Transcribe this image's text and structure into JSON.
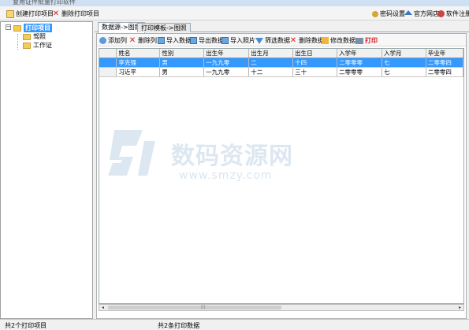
{
  "window": {
    "title": "复用证件批量打印软件"
  },
  "toolbar": {
    "create_label": "创建打印项目",
    "delete_label": "删除打印项目",
    "password_label": "密码设置",
    "shop_label": "官方网店",
    "register_label": "软件注册"
  },
  "sidebar": {
    "root": {
      "toggle": "−",
      "label": "打印项目"
    },
    "items": [
      {
        "label": "驾照"
      },
      {
        "label": "工作证"
      }
    ]
  },
  "tabs": [
    {
      "label": "数据源->图照",
      "active": true
    },
    {
      "label": "打印模板->图照",
      "active": false
    }
  ],
  "panel_toolbar": {
    "add_column": "添加列",
    "delete_column": "删除列",
    "import_data": "导入数据",
    "export_data": "导出数据",
    "import_photo": "导入照片",
    "filter_data": "筛选数据",
    "delete_data": "删除数据",
    "edit_data": "修改数据",
    "print": "打印"
  },
  "table": {
    "columns": [
      "姓名",
      "性别",
      "出生年",
      "出生月",
      "出生日",
      "入学年",
      "入学月",
      "毕业年"
    ],
    "rows": [
      [
        "李克强",
        "男",
        "一九九零",
        "二",
        "十四",
        "二零零零",
        "七",
        "二零零四"
      ],
      [
        "习近平",
        "男",
        "一九九零",
        "十二",
        "三十",
        "二零零零",
        "七",
        "二零零四"
      ]
    ]
  },
  "scrollbar": {
    "left_arrow": "◂",
    "right_arrow": "▸",
    "grip": "|||"
  },
  "watermark": {
    "title": "数码资源网",
    "url": "www.smzy.com"
  },
  "status": {
    "left": "共2个打印项目",
    "center": "共2条打印数据"
  }
}
